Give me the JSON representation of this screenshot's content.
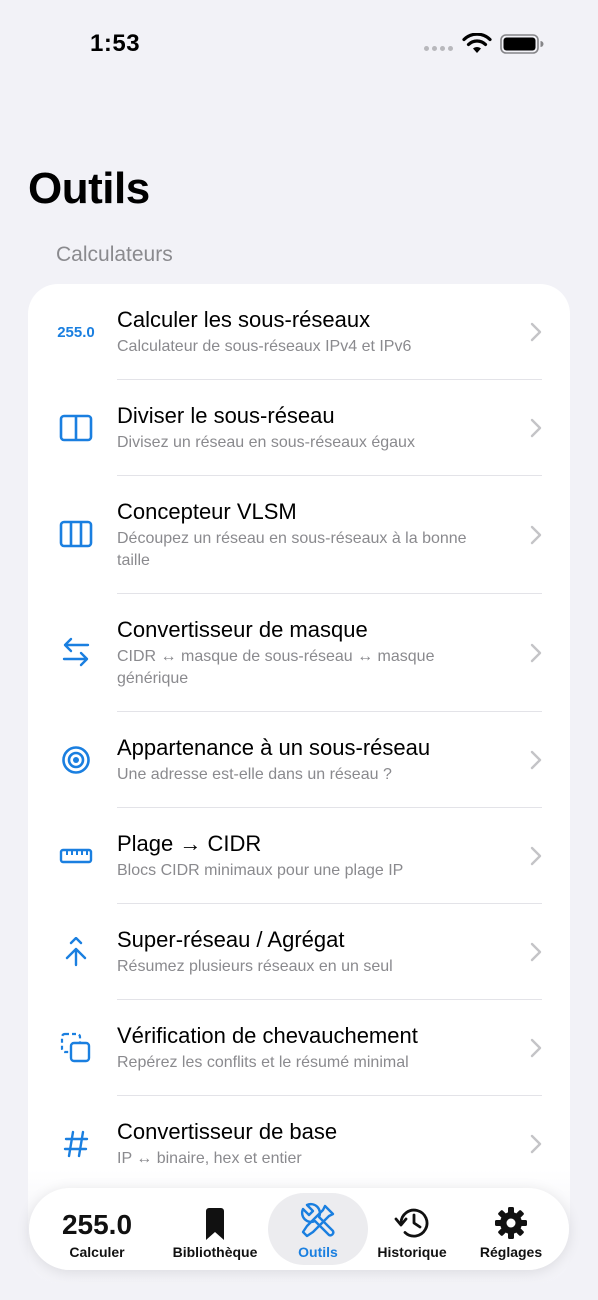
{
  "status": {
    "time": "1:53"
  },
  "page": {
    "title": "Outils",
    "section": "Calculateurs"
  },
  "colors": {
    "accent": "#1a7fe0",
    "background": "#f2f2f7",
    "secondary_text": "#8a8a8e"
  },
  "tools": [
    {
      "icon": "255.0",
      "title": "Calculer les sous-réseaux",
      "subtitle": "Calculateur de sous-réseaux IPv4 et IPv6"
    },
    {
      "icon": "split-two-icon",
      "title": "Diviser le sous-réseau",
      "subtitle": "Divisez un réseau en sous-réseaux égaux"
    },
    {
      "icon": "split-three-icon",
      "title": "Concepteur VLSM",
      "subtitle": "Découpez un réseau en sous-réseaux à la bonne taille"
    },
    {
      "icon": "arrows-swap-icon",
      "title": "Convertisseur de masque",
      "subtitle": "CIDR ↔ masque de sous-réseau ↔ masque générique"
    },
    {
      "icon": "target-icon",
      "title": "Appartenance à un sous-réseau",
      "subtitle": "Une adresse est-elle dans un réseau ?"
    },
    {
      "icon": "ruler-icon",
      "title": "Plage → CIDR",
      "subtitle": "Blocs CIDR minimaux pour une plage IP"
    },
    {
      "icon": "merge-icon",
      "title": "Super-réseau / Agrégat",
      "subtitle": "Résumez plusieurs réseaux en un seul"
    },
    {
      "icon": "overlap-icon",
      "title": "Vérification de chevauchement",
      "subtitle": "Repérez les conflits et le résumé minimal"
    },
    {
      "icon": "hash-icon",
      "title": "Convertisseur de base",
      "subtitle": "IP ↔ binaire, hex et entier"
    }
  ],
  "tabs": [
    {
      "number": "255.0",
      "label": "Calculer"
    },
    {
      "icon": "bookmark-icon",
      "label": "Bibliothèque"
    },
    {
      "icon": "tools-icon",
      "label": "Outils",
      "active": true
    },
    {
      "icon": "history-icon",
      "label": "Historique"
    },
    {
      "icon": "gear-icon",
      "label": "Réglages"
    }
  ]
}
